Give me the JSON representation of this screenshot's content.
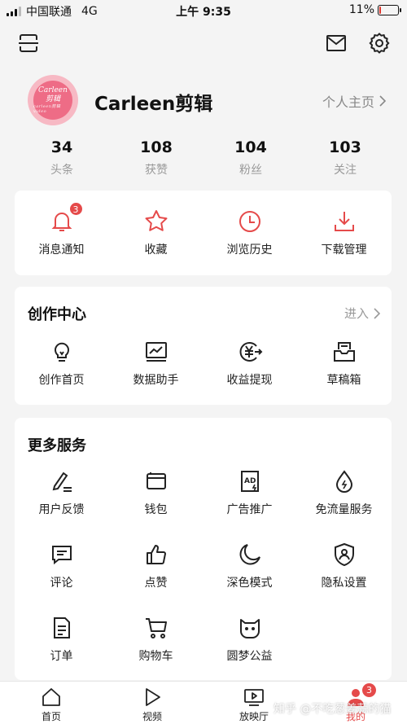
{
  "status_bar": {
    "carrier": "中国联通",
    "network": "4G",
    "time": "上午 9:35",
    "battery_percent": "11%",
    "battery_level": 0.11,
    "battery_color": "#e0352b"
  },
  "topbar": {
    "left_icon": "scan-icon",
    "right_icons": [
      "mail-icon",
      "gear-icon"
    ]
  },
  "profile": {
    "avatar_text": "Carleen",
    "avatar_subtext": "剪辑",
    "avatar_tagline": "carleen剪辑 video",
    "username": "Carleen剪辑",
    "homepage_label": "个人主页",
    "stats": [
      {
        "value": "34",
        "label": "头条"
      },
      {
        "value": "108",
        "label": "获赞"
      },
      {
        "value": "104",
        "label": "粉丝"
      },
      {
        "value": "103",
        "label": "关注"
      }
    ]
  },
  "quick_actions": [
    {
      "label": "消息通知",
      "icon": "bell-icon",
      "badge": "3"
    },
    {
      "label": "收藏",
      "icon": "star-icon"
    },
    {
      "label": "浏览历史",
      "icon": "clock-icon"
    },
    {
      "label": "下载管理",
      "icon": "download-icon"
    }
  ],
  "creation_center": {
    "title": "创作中心",
    "link": "进入",
    "items": [
      {
        "label": "创作首页",
        "icon": "lightbulb-icon"
      },
      {
        "label": "数据助手",
        "icon": "chart-icon"
      },
      {
        "label": "收益提现",
        "icon": "yuan-icon"
      },
      {
        "label": "草稿箱",
        "icon": "drafts-icon"
      }
    ]
  },
  "more_services": {
    "title": "更多服务",
    "items": [
      {
        "label": "用户反馈",
        "icon": "feedback-icon"
      },
      {
        "label": "钱包",
        "icon": "wallet-icon"
      },
      {
        "label": "广告推广",
        "icon": "ad-icon"
      },
      {
        "label": "免流量服务",
        "icon": "data-free-icon"
      },
      {
        "label": "评论",
        "icon": "comment-icon"
      },
      {
        "label": "点赞",
        "icon": "thumbs-up-icon"
      },
      {
        "label": "深色模式",
        "icon": "moon-icon"
      },
      {
        "label": "隐私设置",
        "icon": "privacy-shield-icon"
      },
      {
        "label": "订单",
        "icon": "order-icon"
      },
      {
        "label": "购物车",
        "icon": "cart-icon"
      },
      {
        "label": "圆梦公益",
        "icon": "charity-icon"
      }
    ]
  },
  "bottom_nav": [
    {
      "label": "首页",
      "icon": "home-icon"
    },
    {
      "label": "视频",
      "icon": "play-icon"
    },
    {
      "label": "放映厅",
      "icon": "theater-icon"
    },
    {
      "label": "我的",
      "icon": "profile-icon",
      "badge": "3",
      "active": true
    }
  ],
  "watermark": "知乎 @不吃葱姜蒜的猫",
  "colors": {
    "accent": "#e54a4a",
    "page_bg": "#f4f4f4",
    "card_bg": "#ffffff",
    "muted_text": "#999999"
  }
}
